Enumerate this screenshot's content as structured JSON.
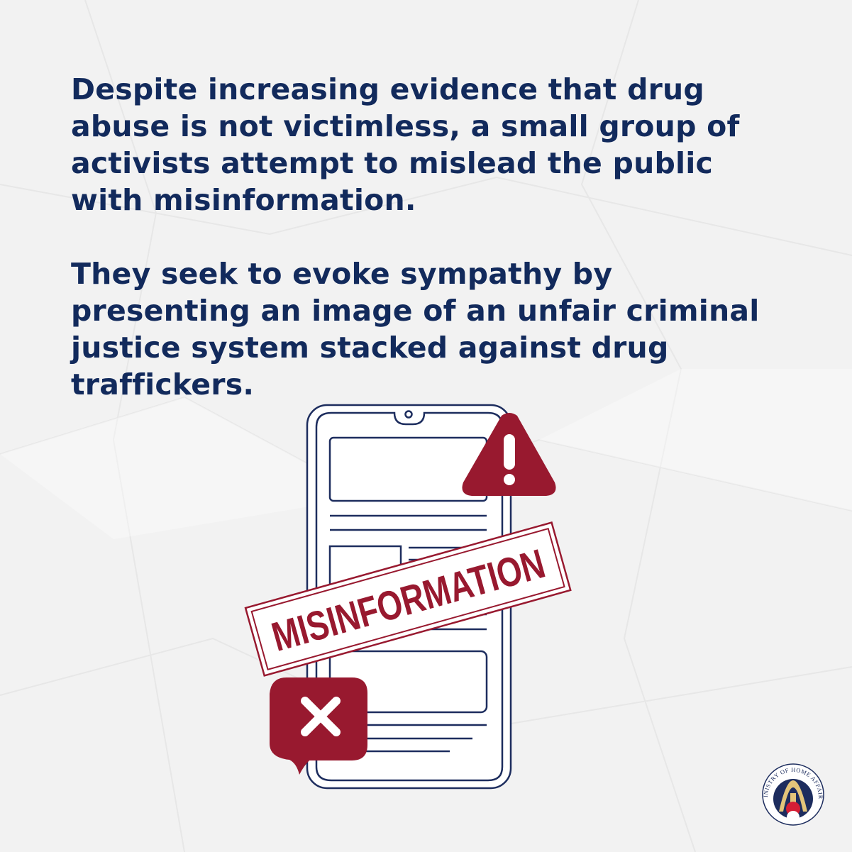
{
  "paragraphs": [
    "Despite increasing evidence that drug abuse is not victimless, a small group of activists attempt to mislead the public with misinformation.",
    "They seek to evoke sympathy by presenting an image of an unfair criminal justice system stacked against drug traffickers."
  ],
  "stamp": {
    "label": "MISINFORMATION"
  },
  "logo": {
    "text": "MINISTRY OF HOME AFFAIRS"
  },
  "icons": {
    "warning": "warning-triangle-icon",
    "error": "error-bubble-icon"
  },
  "colors": {
    "text": "#122a5c",
    "accent": "#98192f",
    "outline": "#1d2d5e",
    "background": "#f2f2f2"
  }
}
